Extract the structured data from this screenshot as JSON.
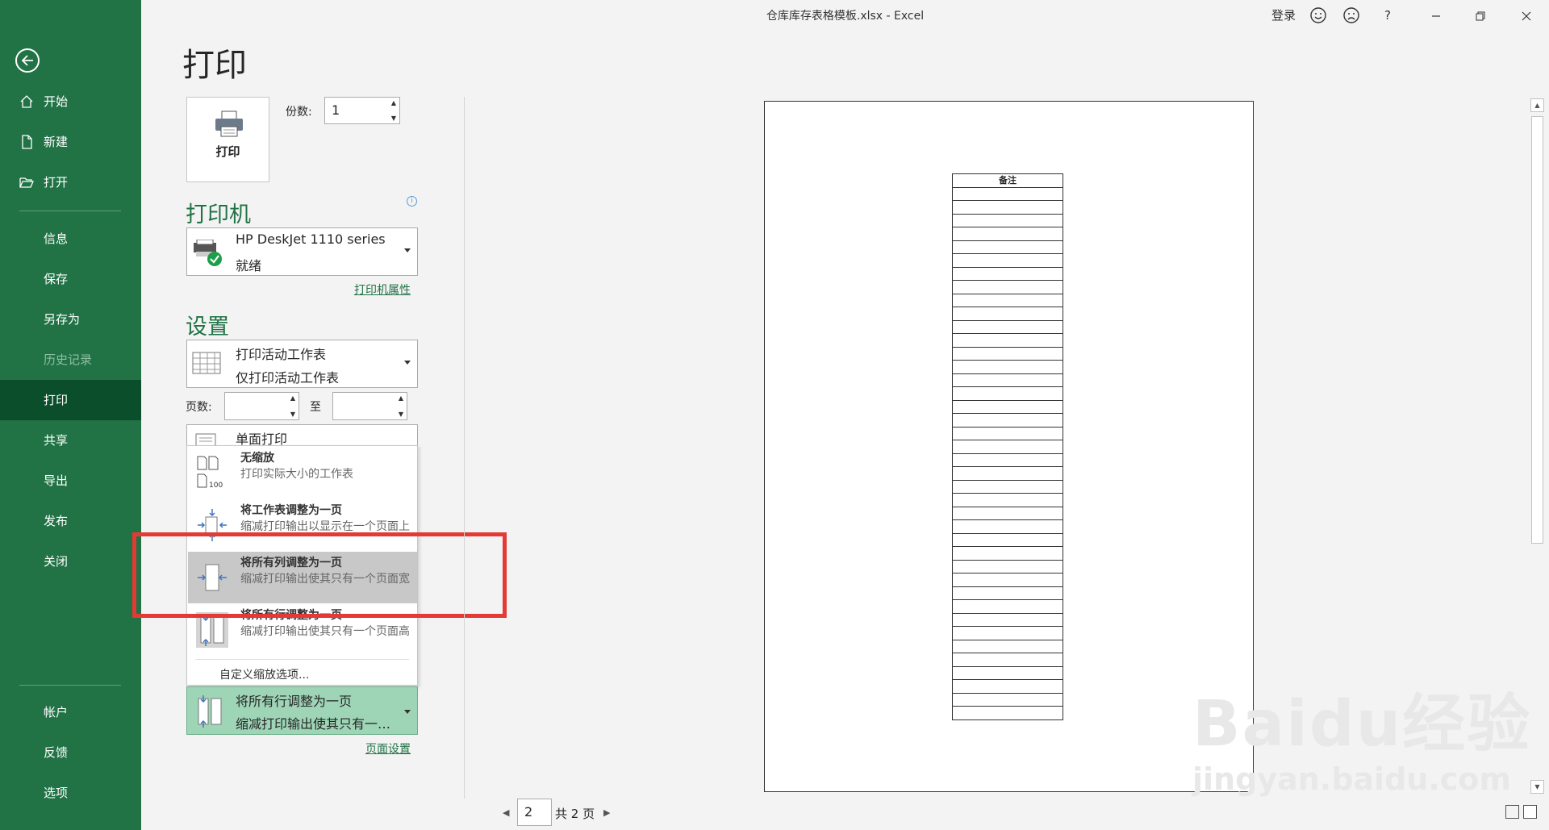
{
  "window": {
    "title": "仓库库存表格模板.xlsx  -  Excel",
    "signin": "登录",
    "help": "?"
  },
  "sidebar": {
    "items": [
      {
        "label": "开始",
        "icon": "home-icon"
      },
      {
        "label": "新建",
        "icon": "new-doc-icon"
      },
      {
        "label": "打开",
        "icon": "open-folder-icon"
      },
      {
        "label": "信息"
      },
      {
        "label": "保存"
      },
      {
        "label": "另存为"
      },
      {
        "label": "历史记录",
        "disabled": true
      },
      {
        "label": "打印",
        "active": true
      },
      {
        "label": "共享"
      },
      {
        "label": "导出"
      },
      {
        "label": "发布"
      },
      {
        "label": "关闭"
      },
      {
        "label": "帐户"
      },
      {
        "label": "反馈"
      },
      {
        "label": "选项"
      }
    ]
  },
  "print": {
    "page_title": "打印",
    "print_button": "打印",
    "copies_label": "份数:",
    "copies_value": "1"
  },
  "printer": {
    "heading": "打印机",
    "name": "HP DeskJet 1110 series",
    "status": "就绪",
    "properties_link": "打印机属性"
  },
  "settings": {
    "heading": "设置",
    "what_title": "打印活动工作表",
    "what_desc": "仅打印活动工作表",
    "pages_label": "页数:",
    "to_label": "至",
    "pages_from": "",
    "pages_to": "",
    "sides": "单面打印",
    "scaling_menu": [
      {
        "title": "无缩放",
        "desc": "打印实际大小的工作表"
      },
      {
        "title": "将工作表调整为一页",
        "desc": "缩减打印输出以显示在一个页面上"
      },
      {
        "title": "将所有列调整为一页",
        "desc": "缩减打印输出使其只有一个页面宽",
        "highlighted": true
      },
      {
        "title": "将所有行调整为一页",
        "desc": "缩减打印输出使其只有一个页面高"
      }
    ],
    "custom_scaling": "自定义缩放选项...",
    "scaling_selected_title": "将所有行调整为一页",
    "scaling_selected_desc": "缩减打印输出使其只有一…",
    "page_setup_link": "页面设置"
  },
  "preview": {
    "header_cell": "备注",
    "row_count": 40,
    "current_page": "2",
    "total_pages": "共 2 页"
  },
  "watermark": {
    "brand": "Baidu经验",
    "url": "jingyan.baidu.com"
  },
  "colors": {
    "sidebar": "#217346",
    "sidebar_active": "#0b4e2c",
    "accent_green": "#217346",
    "highlight_box": "#e53935"
  }
}
